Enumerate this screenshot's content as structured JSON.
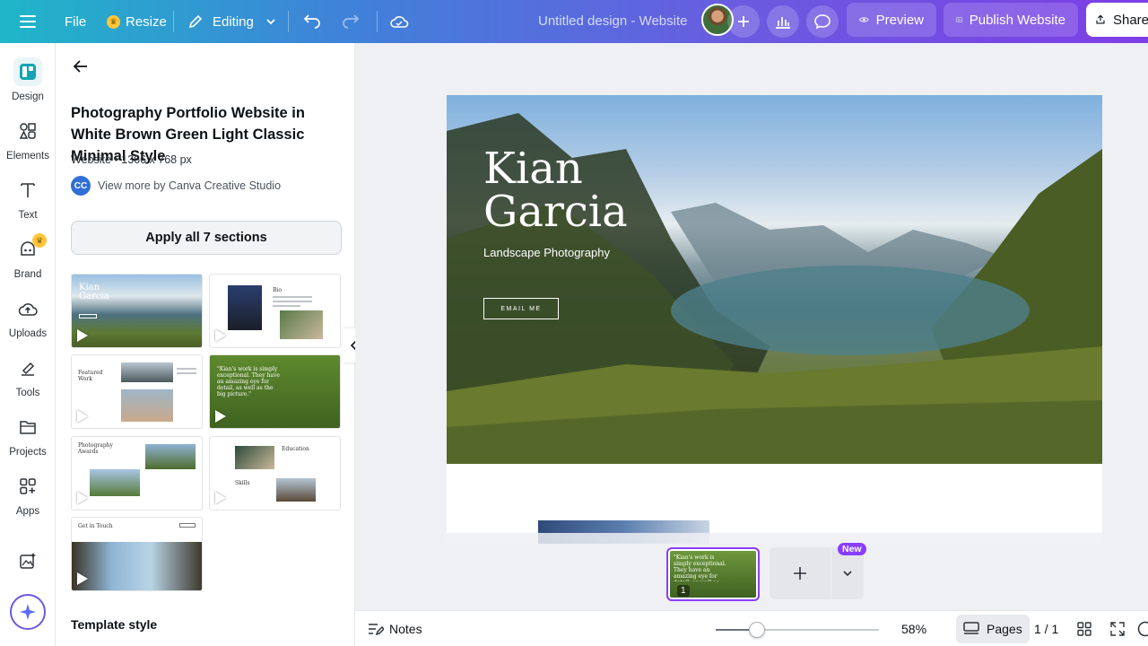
{
  "topbar": {
    "file_label": "File",
    "resize_label": "Resize",
    "editing_label": "Editing",
    "doc_title": "Untitled design - Website",
    "preview_label": "Preview",
    "publish_label": "Publish Website",
    "share_label": "Share"
  },
  "rail": {
    "items": [
      {
        "label": "Design",
        "icon": "design-icon"
      },
      {
        "label": "Elements",
        "icon": "elements-icon"
      },
      {
        "label": "Text",
        "icon": "text-icon"
      },
      {
        "label": "Brand",
        "icon": "brand-icon"
      },
      {
        "label": "Uploads",
        "icon": "uploads-icon"
      },
      {
        "label": "Tools",
        "icon": "tools-icon"
      },
      {
        "label": "Projects",
        "icon": "projects-icon"
      },
      {
        "label": "Apps",
        "icon": "apps-icon"
      }
    ]
  },
  "panel": {
    "template_title": "Photography Portfolio Website in White Brown Green Light Classic Minimal Style",
    "meta": "Website • 1366 x 768 px",
    "creator_initials": "CC",
    "creator_link": "View more by Canva Creative Studio",
    "apply_label": "Apply all 7 sections",
    "section_title": "Template style",
    "thumbs": {
      "t1_name": "Kian Garcia",
      "t2_title": "Bio",
      "t3_title": "Featured Work",
      "t4_quote": "\"Kian's work is simply exceptional. They have an amazing eye for detail, as well as the big picture.\"",
      "t5_title": "Photography Awards",
      "t6_title_a": "Education",
      "t6_title_b": "Skills",
      "t7_title": "Get in Touch"
    }
  },
  "canvas": {
    "hero_name": "Kian Garcia",
    "hero_subtitle": "Landscape Photography",
    "hero_button": "EMAIL ME",
    "strip_quote": "\"Kian's work is simply exceptional. They have an amazing eye for detail, as well as the big picture.\"",
    "strip_page_number": "1",
    "new_badge": "New"
  },
  "bottombar": {
    "notes_label": "Notes",
    "zoom_percent": 58,
    "zoom_label": "58%",
    "pages_label": "Pages",
    "page_count": "1 / 1"
  },
  "colors": {
    "accent": "#8b3dff",
    "topbar_start": "#1fb6c8",
    "topbar_end": "#7d3ee6"
  }
}
